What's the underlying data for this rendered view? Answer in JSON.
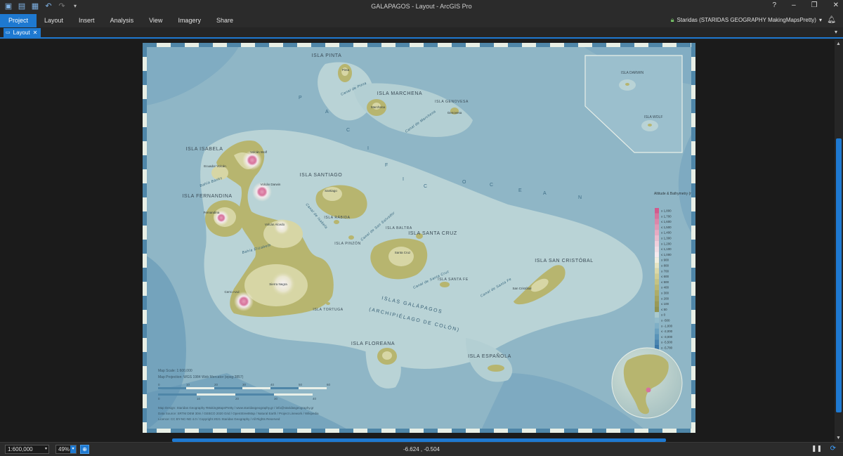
{
  "app": {
    "title": "GALAPAGOS - Layout - ArcGIS Pro",
    "window_controls": [
      "?",
      "–",
      "❐",
      "✕"
    ]
  },
  "ribbon": {
    "tabs": [
      {
        "label": "Project",
        "active": true
      },
      {
        "label": "Layout"
      },
      {
        "label": "Insert"
      },
      {
        "label": "Analysis"
      },
      {
        "label": "View"
      },
      {
        "label": "Imagery"
      },
      {
        "label": "Share"
      }
    ],
    "user": "Staridas (STARIDAS GEOGRAPHY MakingMapsPretty)"
  },
  "doc_tab": {
    "label": "Layout"
  },
  "status": {
    "scale": "1:600,000",
    "zoom": "49%",
    "coordinates": "-6.624 , -0.504"
  },
  "colors": {
    "accent": "#1e79d1",
    "sea_light": "#b9d3d6",
    "sea_mid": "#8fb6c6",
    "sea_deep": "#5f93b4",
    "land_low": "#b7b56f",
    "land_mid": "#d7d6a5",
    "land_high": "#f2efe0",
    "peak": "#d7739c"
  },
  "map": {
    "islands": [
      {
        "name": "ISLA PINTA",
        "peak": "Pinta",
        "elev": "780"
      },
      {
        "name": "ISLA MARCHENA",
        "peak": "Marchena",
        "elev": "343"
      },
      {
        "name": "ISLA GENOVESA",
        "peak": "Genovesa",
        "elev": "64"
      },
      {
        "name": "ISLA ISABELA"
      },
      {
        "name": "ISLA FERNANDINA"
      },
      {
        "name": "ISLA SANTIAGO",
        "peak": "Santiago",
        "elev": "920"
      },
      {
        "name": "ISLA RÁBIDA"
      },
      {
        "name": "ISLA PINZÓN"
      },
      {
        "name": "ISLA BALTRA"
      },
      {
        "name": "ISLA SANTA CRUZ",
        "peak": "Santa Cruz",
        "elev": "864"
      },
      {
        "name": "ISLA SANTA FE"
      },
      {
        "name": "ISLA SAN CRISTÓBAL",
        "peak": "San Cristóbal",
        "elev": "730"
      },
      {
        "name": "ISLA TORTUGA"
      },
      {
        "name": "ISLA FLOREANA"
      },
      {
        "name": "ISLA ESPAÑOLA"
      }
    ],
    "volcanoes": [
      {
        "name": "Volcán Wolf",
        "elev": "1,707"
      },
      {
        "name": "Ecuador Volcán",
        "elev": "790"
      },
      {
        "name": "Volcán Darwin",
        "elev": "1,330"
      },
      {
        "name": "Fernandina",
        "elev": "1,476"
      },
      {
        "name": "Volcán Alcedo",
        "elev": "1,130"
      },
      {
        "name": "Sierra Negra",
        "elev": "1,140"
      },
      {
        "name": "Cerro Azul",
        "elev": "1,640"
      }
    ],
    "channels": [
      "Canal de Pinta",
      "Canal de Marchena",
      "Bahía Banks",
      "Canal de Isabela",
      "Canal de San Salvador",
      "Canal de Santa Cruz",
      "Canal de Santa Fe",
      "Bahía Elizabeth"
    ],
    "ocean_label": [
      "P",
      "A",
      "C",
      "I",
      "F",
      "I",
      "C",
      "O",
      "C",
      "E",
      "A",
      "N"
    ],
    "archipelago_label": "ISLAS GALÁPAGOS",
    "archipelago_sub": "(ARCHIPIÉLAGO DE COLÓN)",
    "inset": {
      "darwin": "ISLA DARWIN",
      "wolf": "ISLA WOLF"
    },
    "legend": {
      "title": "Altitude & Bathymetry (m)",
      "items": [
        "≤ 1,800",
        "≤ 1,700",
        "≤ 1,600",
        "≤ 1,500",
        "≤ 1,400",
        "≤ 1,300",
        "≤ 1,200",
        "≤ 1,100",
        "≤ 1,000",
        "≤ 900",
        "≤ 800",
        "≤ 700",
        "≤ 600",
        "≤ 500",
        "≤ 400",
        "≤ 300",
        "≤ 200",
        "≤ 100",
        "≤ 50",
        "≤ 0",
        "≤ -500",
        "≤ -1,000",
        "≤ -2,000",
        "≤ -3,000",
        "≤ -5,500",
        "≤ -5,780"
      ]
    },
    "scale_text": "Map Scale: 1:600,000",
    "projection_text": "Map Projection: WGS 1984 Web Mercator (epsg:3857)",
    "scalebar_km": [
      "0",
      "10",
      "20",
      "30",
      "40",
      "50",
      "60"
    ],
    "scalebar_mi": [
      "0",
      "10",
      "20",
      "30",
      "40"
    ],
    "credits": [
      "Map Design: Staridas Geography  #MakingMapsPretty  /  www.staridasgeography.gr  /  info@staridasgeography.gr",
      "Data Source: SRTM DEM 30m / GEBCO 2020 Grid / OpenStreetMap / Natural Earth / Project Linework / Wikipedia",
      "Licence: CC BY-NC-ND 4.0  /  Copyright 2021 Staridas Geography  /  All Rights Reserved"
    ]
  }
}
